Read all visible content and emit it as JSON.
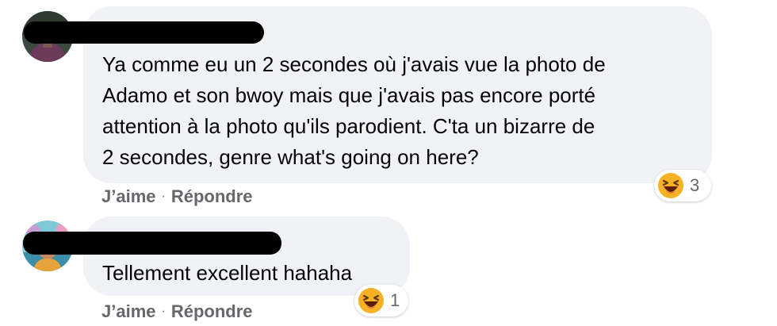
{
  "comments": [
    {
      "text": "Ya comme eu un 2 secondes où j'avais vue la photo de\nAdamo et son bwoy mais que j'avais pas encore porté\nattention à la photo qu'ils parodient. C'ta un bizarre de\n2 secondes, genre what's going on here?",
      "reaction_icon": "laughing-emoji-icon",
      "reaction_count": "3",
      "like_label": "J’aime",
      "separator": "·",
      "reply_label": "Répondre"
    },
    {
      "text": "Tellement excellent hahaha",
      "reaction_icon": "laughing-emoji-icon",
      "reaction_count": "1",
      "like_label": "J’aime",
      "separator": "·",
      "reply_label": "Répondre"
    }
  ],
  "colors": {
    "bubble_bg": "#f0f2f5",
    "action_text": "#65676b",
    "emoji_yellow": "#f7b125"
  }
}
